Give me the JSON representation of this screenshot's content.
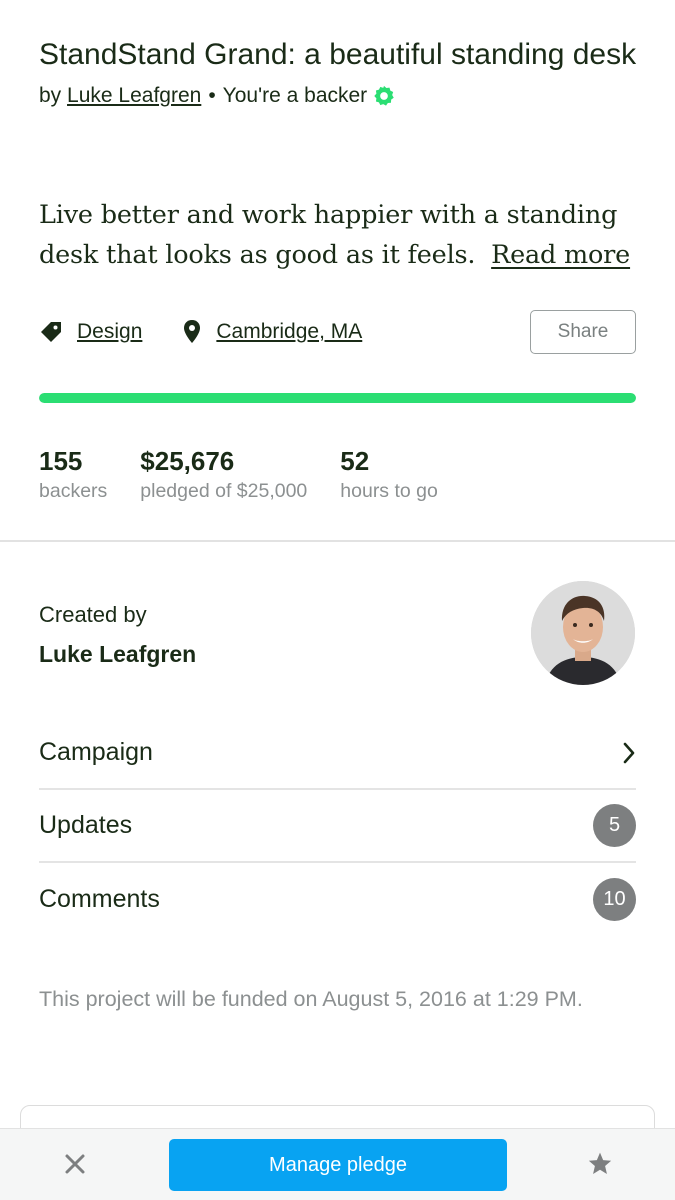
{
  "project": {
    "title": "StandStand Grand: a beautiful standing desk",
    "by_prefix": "by",
    "creator_link": "Luke Leafgren",
    "separator": "•",
    "backer_status": "You're a backer",
    "blurb": "Live better and work happier with a standing desk that looks as good as it feels.",
    "read_more": "Read more",
    "category": "Design",
    "location": "Cambridge, MA",
    "share_label": "Share",
    "funding_progress_percent": 100
  },
  "stats": [
    {
      "value": "155",
      "label": "backers"
    },
    {
      "value": "$25,676",
      "label": "pledged of $25,000"
    },
    {
      "value": "52",
      "label": "hours to go"
    }
  ],
  "creator": {
    "label": "Created by",
    "name": "Luke Leafgren"
  },
  "nav": {
    "campaign": "Campaign",
    "updates": "Updates",
    "updates_count": "5",
    "comments": "Comments",
    "comments_count": "10"
  },
  "funded_note": "This project will be funded on August 5, 2016 at 1:29 PM.",
  "bottom_bar": {
    "manage_pledge": "Manage pledge"
  },
  "colors": {
    "accent_green": "#2bde73",
    "button_blue": "#08a3f2",
    "badge_gray": "#7d7f80",
    "text_dark": "#1a2b17",
    "text_muted": "#8c9091"
  },
  "icons": {
    "backer": "backer-badge-icon",
    "category": "tag-icon",
    "location": "location-pin-icon",
    "campaign": "chevron-right-icon",
    "close": "close-icon",
    "star": "star-icon"
  }
}
